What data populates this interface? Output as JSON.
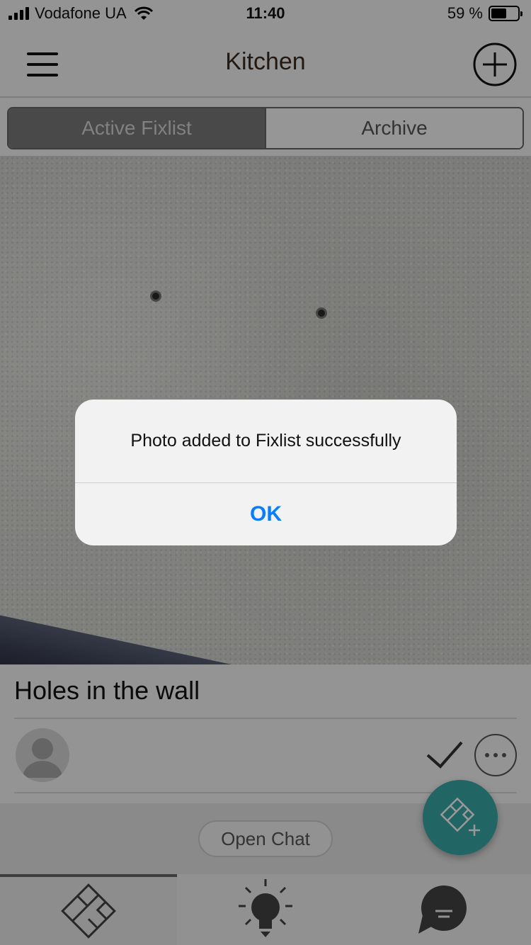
{
  "status_bar": {
    "carrier": "Vodafone UA",
    "time": "11:40",
    "battery": "59 %",
    "battery_level": 0.59
  },
  "nav": {
    "title": "Kitchen",
    "menu_icon": "hamburger-menu-icon",
    "add_icon": "plus-circle-icon"
  },
  "segments": {
    "active_label": "Active Fixlist",
    "archive_label": "Archive",
    "selected": "Active Fixlist"
  },
  "photo": {
    "zoom_icon": "magnifier-icon"
  },
  "item": {
    "title": "Holes in the wall",
    "avatar_icon": "user-avatar-icon",
    "check_icon": "checkmark-icon",
    "more_icon": "ellipsis-circle-icon"
  },
  "chat": {
    "open_chat_label": "Open Chat"
  },
  "fab": {
    "icon": "add-fixlist-icon"
  },
  "tabs": [
    {
      "icon": "floorplan-icon",
      "active": true
    },
    {
      "icon": "lightbulb-icon",
      "active": false
    },
    {
      "icon": "chat-bubble-icon",
      "active": false
    }
  ],
  "alert": {
    "message": "Photo added to Fixlist successfully",
    "ok_label": "OK"
  },
  "colors": {
    "accent_blue": "#0a7cff",
    "fab_teal": "#3aa8a8"
  }
}
